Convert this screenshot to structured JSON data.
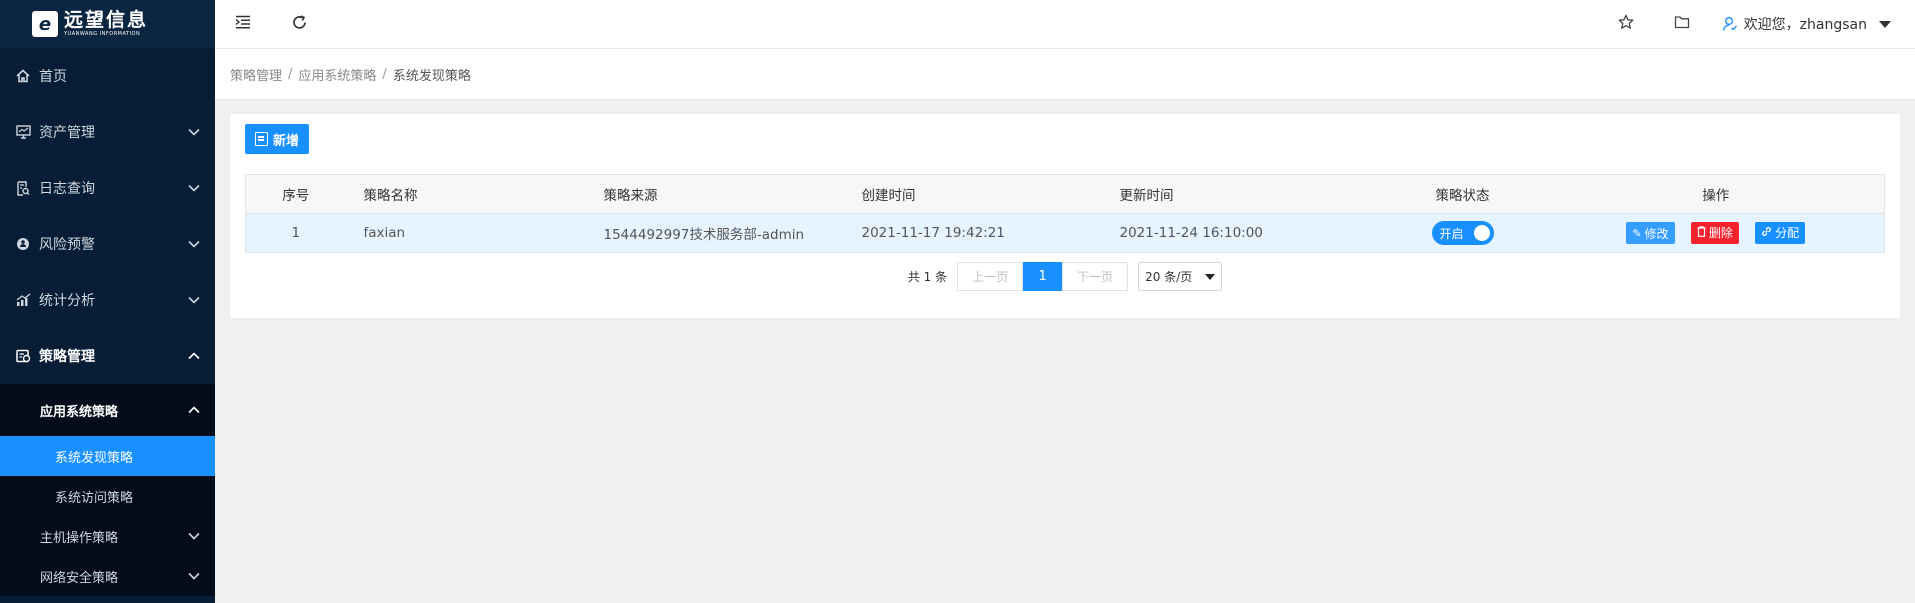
{
  "app": {
    "logo_cn": "远望信息",
    "logo_en": "YUANWANG INFORMATION",
    "logo_letter": "e"
  },
  "sidebar": {
    "items": [
      {
        "label": "首页",
        "icon": "home-icon"
      },
      {
        "label": "资产管理",
        "icon": "monitor-icon"
      },
      {
        "label": "日志查询",
        "icon": "log-search-icon"
      },
      {
        "label": "风险预警",
        "icon": "alert-icon"
      },
      {
        "label": "统计分析",
        "icon": "chart-icon"
      },
      {
        "label": "策略管理",
        "icon": "policy-icon"
      }
    ],
    "sub": {
      "group_label": "应用系统策略",
      "children": [
        "系统发现策略",
        "系统访问策略"
      ],
      "host_label": "主机操作策略",
      "network_label": "网络安全策略"
    }
  },
  "header": {
    "welcome": "欢迎您，zhangsan"
  },
  "breadcrumb": [
    "策略管理",
    "应用系统策略",
    "系统发现策略"
  ],
  "toolbar": {
    "add_label": "新增"
  },
  "table": {
    "columns": [
      "序号",
      "策略名称",
      "策略来源",
      "创建时间",
      "更新时间",
      "策略状态",
      "操作"
    ],
    "rows": [
      {
        "index": "1",
        "name": "faxian",
        "source": "1544492997技术服务部-admin",
        "created": "2021-11-17 19:42:21",
        "updated": "2021-11-24 16:10:00",
        "status": "开启",
        "actions": {
          "edit": "修改",
          "delete": "删除",
          "assign": "分配"
        }
      }
    ]
  },
  "pagination": {
    "total": "共 1 条",
    "prev": "上一页",
    "page": "1",
    "next": "下一页",
    "page_size": "20 条/页"
  },
  "colors": {
    "sidebar_bg": "#061d35",
    "accent": "#1890ff",
    "danger": "#f5222d"
  }
}
